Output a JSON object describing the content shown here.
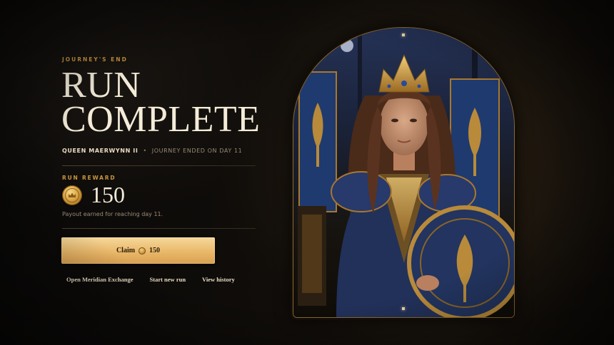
{
  "header": {
    "eyebrow": "JOURNEY'S END",
    "title_line1": "RUN",
    "title_line2": "COMPLETE",
    "hero_name": "QUEEN MAERWYNN II",
    "separator": "•",
    "journey_status": "JOURNEY ENDED ON DAY 11"
  },
  "reward": {
    "label": "RUN REWARD",
    "amount": "150",
    "payout_text": "Payout earned for reaching day 11.",
    "coin_icon": "crown-coin-icon"
  },
  "actions": {
    "claim_label": "Claim",
    "claim_amount": "150",
    "links": [
      "Open Meridian Exchange",
      "Start new run",
      "View history"
    ]
  },
  "portrait": {
    "subject": "queen-portrait",
    "frame_color": "#8c6a34"
  },
  "colors": {
    "accent_gold": "#c9953f",
    "button_gold": "#e9b86a",
    "background": "#0c0a08",
    "text_light": "#f4ecd8"
  }
}
